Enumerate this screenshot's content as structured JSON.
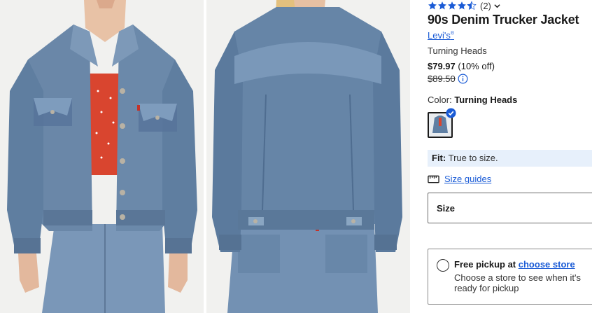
{
  "product": {
    "rating_count": "(2)",
    "rating_value": 4.5,
    "title": "90s Denim Trucker Jacket",
    "brand": "Levi's",
    "brand_mark": "®",
    "variant": "Turning Heads",
    "price_now": "$79.97",
    "discount": "(10% off)",
    "price_was": "$89.50",
    "color_label": "Color:",
    "color_value": "Turning Heads",
    "fit_label": "Fit:",
    "fit_value": "True to size.",
    "size_guides": "Size guides",
    "size_label": "Size"
  },
  "pickup": {
    "title": "Free pickup at",
    "link": "choose store",
    "subtitle": "Choose a store to see when it's ready for pickup"
  },
  "gallery": {
    "images": [
      "front view",
      "back view"
    ]
  },
  "colors": {
    "accent": "#1a5bd6",
    "fit_bg": "#e7f0fb",
    "denim": "#6a87a8"
  }
}
